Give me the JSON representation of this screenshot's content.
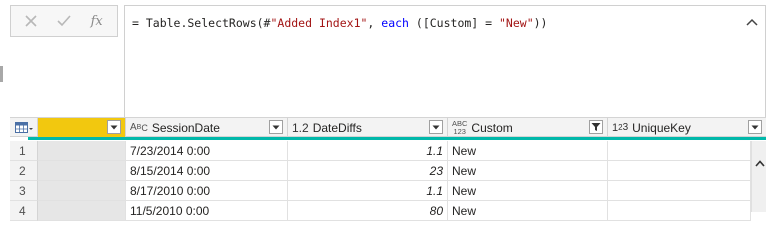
{
  "formula_bar": {
    "cancel_icon": "x-icon",
    "confirm_icon": "check-icon",
    "fx_label": "fx",
    "formula_prefix": "= Table.SelectRows(#",
    "formula_step": "\"Added Index1\"",
    "formula_comma": ", ",
    "formula_keyword": "each",
    "formula_mid": " ([Custom] = ",
    "formula_value": "\"New\"",
    "formula_suffix": "))"
  },
  "grid": {
    "columns": [
      {
        "type_icon": "",
        "name": "",
        "filtered": false
      },
      {
        "type_icon": "ABC",
        "name": "SessionDate",
        "filtered": false
      },
      {
        "type_icon": "1.2",
        "name": "DateDiffs",
        "filtered": false
      },
      {
        "type_icon": "ABC123",
        "name": "Custom",
        "filtered": true
      },
      {
        "type_icon": "123",
        "name": "UniqueKey",
        "filtered": false
      }
    ],
    "rows": [
      {
        "num": "1",
        "session_date": "7/23/2014 0:00",
        "date_diffs": "1.1",
        "custom": "New",
        "unique_key": ""
      },
      {
        "num": "2",
        "session_date": "8/15/2014 0:00",
        "date_diffs": "23",
        "custom": "New",
        "unique_key": ""
      },
      {
        "num": "3",
        "session_date": "8/17/2010 0:00",
        "date_diffs": "1.1",
        "custom": "New",
        "unique_key": ""
      },
      {
        "num": "4",
        "session_date": "11/5/2010 0:00",
        "date_diffs": "80",
        "custom": "New",
        "unique_key": ""
      }
    ]
  },
  "colors": {
    "accent": "#01b8aa",
    "selected_header": "#f2c80f",
    "keyword": "#0000ff",
    "string": "#a31515"
  }
}
